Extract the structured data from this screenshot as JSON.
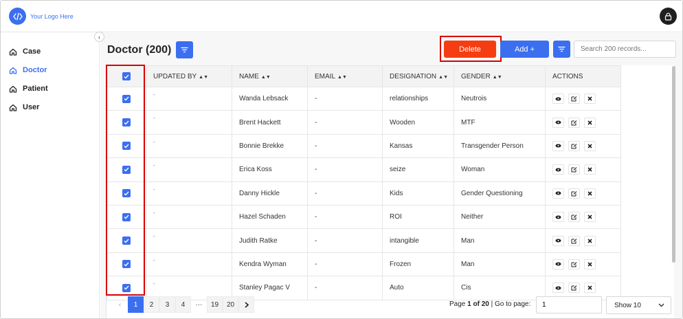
{
  "header": {
    "logo_text": "Your Logo Here"
  },
  "sidebar": {
    "items": [
      {
        "label": "Case",
        "active": false
      },
      {
        "label": "Doctor",
        "active": true
      },
      {
        "label": "Patient",
        "active": false
      },
      {
        "label": "User",
        "active": false
      }
    ]
  },
  "main": {
    "title": "Doctor (200)",
    "delete_label": "Delete",
    "add_label": "Add +",
    "search_placeholder": "Search 200 records..."
  },
  "table": {
    "columns": [
      "UPDATED BY",
      "NAME",
      "EMAIL",
      "DESIGNATION",
      "GENDER",
      "ACTIONS"
    ],
    "rows": [
      {
        "updated_by": "-",
        "name": "Wanda Lebsack",
        "email": "-",
        "designation": "relationships",
        "gender": "Neutrois"
      },
      {
        "updated_by": "-",
        "name": "Brent Hackett",
        "email": "-",
        "designation": "Wooden",
        "gender": "MTF"
      },
      {
        "updated_by": "-",
        "name": "Bonnie Brekke",
        "email": "-",
        "designation": "Kansas",
        "gender": "Transgender Person"
      },
      {
        "updated_by": "-",
        "name": "Erica Koss",
        "email": "-",
        "designation": "seize",
        "gender": "Woman"
      },
      {
        "updated_by": "-",
        "name": "Danny Hickle",
        "email": "-",
        "designation": "Kids",
        "gender": "Gender Questioning"
      },
      {
        "updated_by": "-",
        "name": "Hazel Schaden",
        "email": "-",
        "designation": "ROI",
        "gender": "Neither"
      },
      {
        "updated_by": "-",
        "name": "Judith Ratke",
        "email": "-",
        "designation": "intangible",
        "gender": "Man"
      },
      {
        "updated_by": "-",
        "name": "Kendra Wyman",
        "email": "-",
        "designation": "Frozen",
        "gender": "Man"
      },
      {
        "updated_by": "-",
        "name": "Stanley Pagac V",
        "email": "-",
        "designation": "Auto",
        "gender": "Cis"
      }
    ]
  },
  "pagination": {
    "pages": [
      "1",
      "2",
      "3",
      "4",
      "···",
      "19",
      "20"
    ],
    "active_page": "1",
    "page_prefix": "Page ",
    "current": "1",
    "of_word": " of ",
    "total": "20",
    "goto_label": " | Go to page:",
    "goto_value": "1",
    "show_label": "Show 10"
  },
  "colors": {
    "accent": "#3b6ff0",
    "delete": "#f63d12",
    "highlight": "#d90000"
  },
  "icons": {
    "logo": "code-brackets-icon",
    "avatar": "user-lock-icon",
    "nav": "home-icon",
    "filter": "filter-icon",
    "view": "eye-icon",
    "edit": "edit-icon",
    "delete": "close-icon"
  }
}
